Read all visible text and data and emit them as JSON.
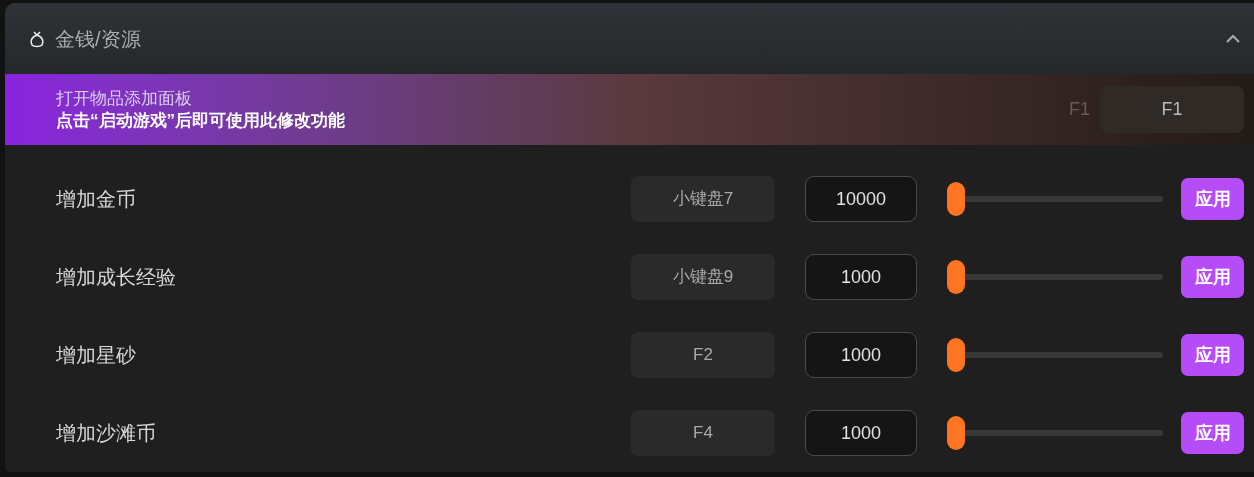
{
  "section": {
    "title": "金钱/资源",
    "expanded": true
  },
  "banner": {
    "title": "打开物品添加面板",
    "subtitle": "点击“启动游戏”后即可使用此修改功能",
    "hint": "F1",
    "hotkey": "F1"
  },
  "rows": [
    {
      "label": "增加金币",
      "hotkey": "小键盘7",
      "value": "10000",
      "level": 0,
      "button": "应用"
    },
    {
      "label": "增加成长经验",
      "hotkey": "小键盘9",
      "value": "1000",
      "level": 0,
      "button": "应用"
    },
    {
      "label": "增加星砂",
      "hotkey": "F2",
      "value": "1000",
      "level": 0,
      "button": "应用"
    },
    {
      "label": "增加沙滩币",
      "hotkey": "F4",
      "value": "1000",
      "level": 0,
      "button": "应用"
    }
  ]
}
